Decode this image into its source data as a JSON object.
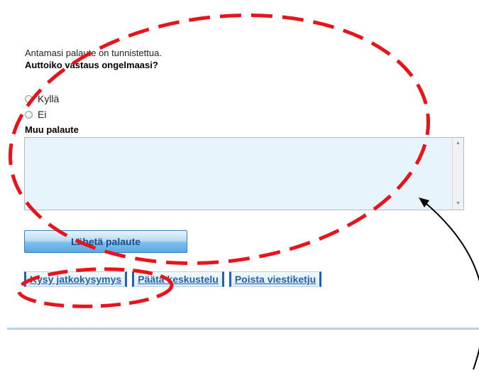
{
  "feedback": {
    "info_text": "Antamasi palaute on tunnistettua.",
    "question": "Auttoiko vastaus ongelmaasi?",
    "options": [
      {
        "label": "Kyllä",
        "selected": false
      },
      {
        "label": "Ei",
        "selected": false
      }
    ],
    "other_label": "Muu palaute",
    "other_value": "",
    "send_button": "Lähetä palaute"
  },
  "actions": [
    {
      "label": "Kysy jatkokysymys"
    },
    {
      "label": "Päätä keskustelu"
    },
    {
      "label": "Poista viestiketju"
    }
  ],
  "annotations": {
    "color": "#e8141c",
    "arrow_color": "#000000",
    "shapes": [
      "dashed-ellipse-feedback-form",
      "dashed-ellipse-follow-up-link",
      "curved-arrow-to-textarea"
    ]
  }
}
